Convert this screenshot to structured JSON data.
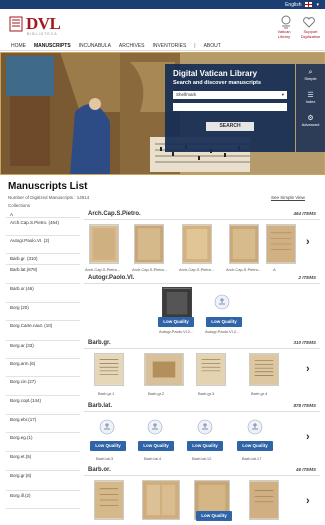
{
  "topbar": {
    "language": "English"
  },
  "header": {
    "logo_text": "DVL",
    "logo_sub": "BIBLIOTECA",
    "vatican_label": "Vatican Library",
    "support_label": "Support Digitization"
  },
  "nav": {
    "items": [
      "HOME",
      "MANUSCRIPTS",
      "INCUNABULA",
      "ARCHIVES",
      "INVENTORIES",
      "|",
      "ABOUT"
    ],
    "active": "MANUSCRIPTS"
  },
  "search": {
    "title": "Digital Vatican Library",
    "subtitle": "Search and discover manuscripts",
    "select_value": "Shelfmark",
    "button": "SEARCH"
  },
  "side_options": [
    "Simple",
    "Index",
    "Advanced"
  ],
  "list": {
    "title": "Manuscripts List",
    "count_text": "Number of Digitized Manuscripts : 14914",
    "simple_view": "See Simple View",
    "collections_label": "Collections"
  },
  "collections": [
    "A",
    "Arch.Cap.S.Pietro. (464)",
    "Autogr.Paolo.VI. (2)",
    "Barb.gr. (310)",
    "Barb.lat.(878)",
    "Barb.or.(46)",
    "Borg (20)",
    "Borg.Carte.naut. (10)",
    "Borg.ar.(33)",
    "Borg.arm.(6)",
    "Borg.cin.(27)",
    "Borg.copt.(144)",
    "Borg.ebr.(17)",
    "Borg.eg.(1)",
    "Borg.et.(5)",
    "Borg.gr.(8)",
    "Borg.ill.(2)"
  ],
  "sections": [
    {
      "name": "Arch.Cap.S.Pietro.",
      "count": "464 ITEMS",
      "captions": [
        "Arch.Cap.S.Pietro...",
        "Arch.Cap.S.Pietro...",
        "Arch.Cap.S.Pietro...",
        "Arch.Cap.S.Pietro...",
        "A"
      ]
    },
    {
      "name": "Autogr.Paolo.VI.",
      "count": "2 ITEMS",
      "captions": [
        "Autogr.Paolo.VI.2...",
        "Autogr.Paolo.VI.2..."
      ],
      "badges": [
        "Low Quality",
        "Low Quality"
      ]
    },
    {
      "name": "Barb.gr.",
      "count": "310 ITEMS",
      "captions": [
        "Barb.gr.1",
        "Barb.gr.2",
        "Barb.gr.3",
        "Barb.gr.4"
      ]
    },
    {
      "name": "Barb.lat.",
      "count": "878 ITEMS",
      "captions": [
        "Barb.lat.3",
        "Barb.lat.4",
        "Barb.lat.12",
        "Barb.lat.17"
      ],
      "badges": [
        "Low Quality",
        "Low Quality",
        "Low Quality",
        "Low Quality"
      ]
    },
    {
      "name": "Barb.or.",
      "count": "46 ITEMS",
      "badges": [
        "Low Quality"
      ]
    }
  ]
}
